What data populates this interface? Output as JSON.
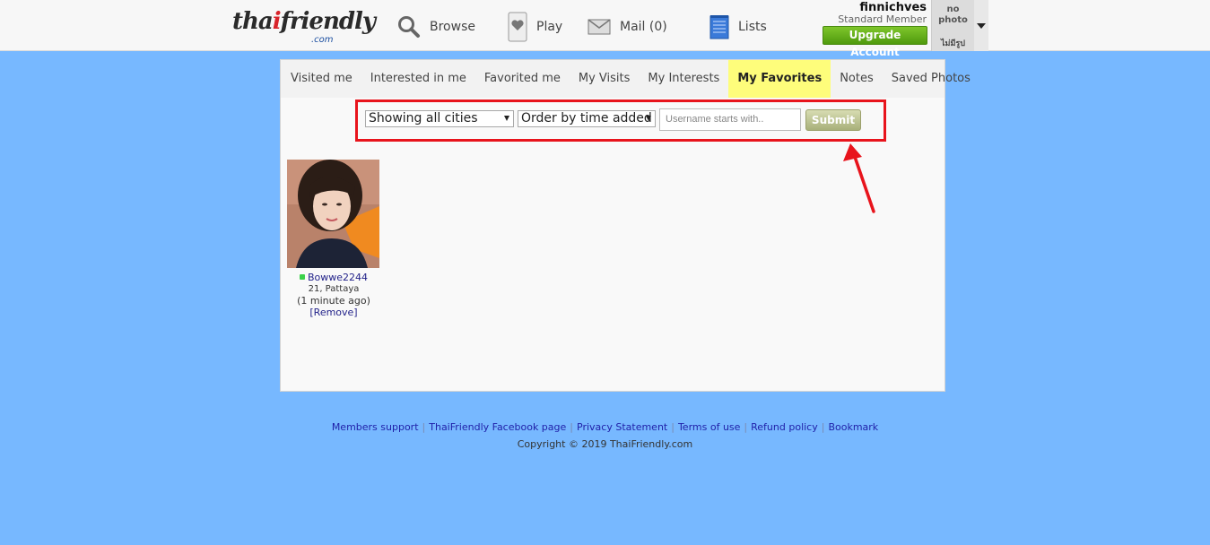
{
  "header": {
    "logo": {
      "part1": "tha",
      "part2": "i",
      "part3": "friendly",
      "sub": ".com"
    },
    "nav": [
      {
        "label": "Browse",
        "icon": "magnifier-icon"
      },
      {
        "label": "Play",
        "icon": "card-heart-icon"
      },
      {
        "label": "Mail (0)",
        "icon": "envelope-icon"
      },
      {
        "label": "Lists",
        "icon": "notepad-icon"
      }
    ],
    "user": {
      "name": "finnichves",
      "type": "Standard Member",
      "upgrade_label": "Upgrade Account"
    },
    "nophoto": {
      "line1": "no",
      "line2": "photo",
      "thai": "ไม่มีรูป"
    }
  },
  "tabs": [
    {
      "label": "Visited me",
      "active": false
    },
    {
      "label": "Interested in me",
      "active": false
    },
    {
      "label": "Favorited me",
      "active": false
    },
    {
      "label": "My Visits",
      "active": false
    },
    {
      "label": "My Interests",
      "active": false
    },
    {
      "label": "My Favorites",
      "active": true
    },
    {
      "label": "Notes",
      "active": false
    },
    {
      "label": "Saved Photos",
      "active": false
    }
  ],
  "filters": {
    "city_select": "Showing all cities",
    "order_select": "Order by time added",
    "username_placeholder": "Username starts with..",
    "submit_label": "Submit"
  },
  "favorites": [
    {
      "username": "Bowwe2244",
      "age_city": "21, Pattaya",
      "last_seen": "(1 minute ago)",
      "remove_label": "[Remove]",
      "online": true
    }
  ],
  "footer": {
    "links": [
      "Members support",
      "ThaiFriendly Facebook page",
      "Privacy Statement",
      "Terms of use",
      "Refund policy",
      "Bookmark"
    ],
    "copyright": "Copyright © 2019 ThaiFriendly.com"
  },
  "colors": {
    "background": "#77b8ff",
    "active_tab": "#fefd7b",
    "highlight_red": "#e8141c",
    "upgrade_green": "#5aa816"
  }
}
